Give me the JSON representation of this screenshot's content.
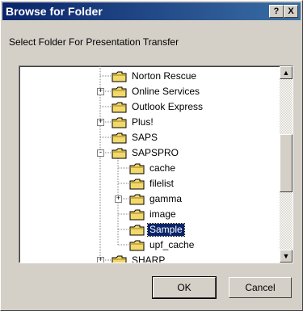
{
  "dialog": {
    "title": "Browse for Folder",
    "help_label": "?",
    "close_label": "X",
    "prompt": "Select Folder For Presentation Transfer"
  },
  "tree": {
    "items": [
      {
        "label": "Norton Rescue",
        "level": 1,
        "expander": ""
      },
      {
        "label": "Online Services",
        "level": 1,
        "expander": "+"
      },
      {
        "label": "Outlook Express",
        "level": 1,
        "expander": ""
      },
      {
        "label": "Plus!",
        "level": 1,
        "expander": "+"
      },
      {
        "label": "SAPS",
        "level": 1,
        "expander": ""
      },
      {
        "label": "SAPSPRO",
        "level": 1,
        "expander": "-"
      },
      {
        "label": "cache",
        "level": 2,
        "expander": ""
      },
      {
        "label": "filelist",
        "level": 2,
        "expander": ""
      },
      {
        "label": "gamma",
        "level": 2,
        "expander": "+"
      },
      {
        "label": "image",
        "level": 2,
        "expander": ""
      },
      {
        "label": "Sample",
        "level": 2,
        "expander": "",
        "selected": true
      },
      {
        "label": "upf_cache",
        "level": 2,
        "expander": ""
      },
      {
        "label": "SHARP",
        "level": 1,
        "expander": "+"
      }
    ]
  },
  "buttons": {
    "ok": "OK",
    "cancel": "Cancel"
  },
  "colors": {
    "title_bar": "#0a246a",
    "selection": "#0a246a",
    "face": "#d4d0c8",
    "folder": "#f2d96b"
  }
}
